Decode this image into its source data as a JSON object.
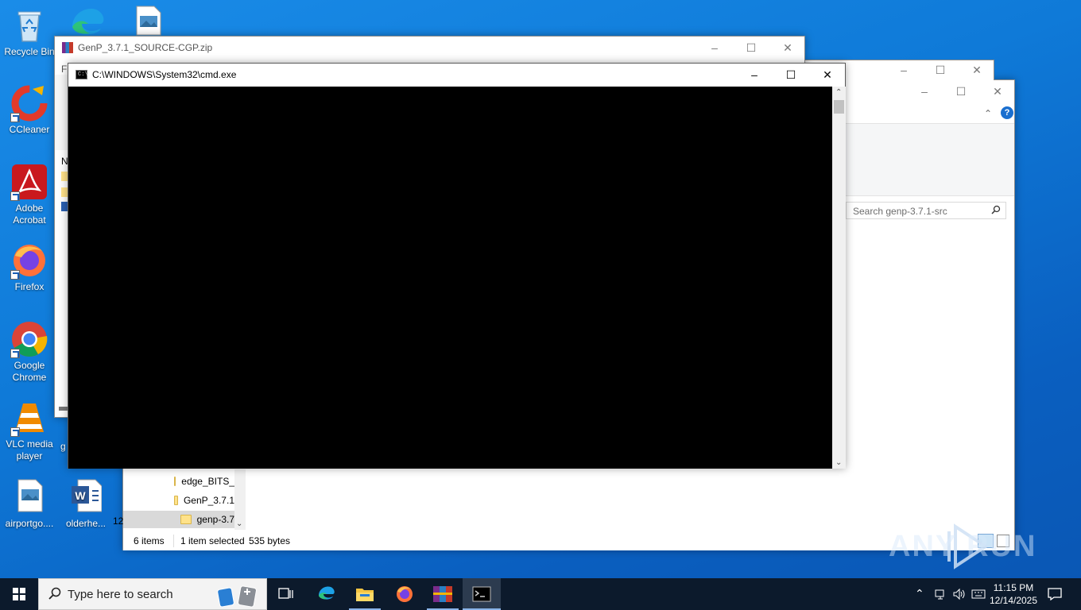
{
  "desktop": {
    "icons": [
      {
        "label": "Recycle Bin"
      },
      {
        "label": "CCleaner"
      },
      {
        "label": "Adobe Acrobat"
      },
      {
        "label": "Firefox"
      },
      {
        "label": "Google Chrome"
      },
      {
        "label": "VLC media player"
      },
      {
        "label": "airportgo...."
      },
      {
        "label": "olderhe..."
      }
    ]
  },
  "winrar_window": {
    "title": "GenP_3.7.1_SOURCE-CGP.zip",
    "menu_partial": "Fi",
    "col_partial": "N"
  },
  "explorer_window": {
    "search_placeholder": "Search genp-3.7.1-src",
    "files": [
      {
        "name": "edge_BITS_"
      },
      {
        "name": "GenP_3.7.1"
      },
      {
        "name": "genp-3.7"
      }
    ],
    "left_partial": "12",
    "status_items": "6 items",
    "status_selected": "1 item selected",
    "status_size": "535 bytes"
  },
  "cmd_window": {
    "title": "C:\\WINDOWS\\System32\\cmd.exe"
  },
  "taskbar": {
    "search_placeholder": "Type here to search",
    "time": "11:15 PM",
    "date": "12/14/2025"
  },
  "watermark": {
    "text": "ANY RUN"
  },
  "colors": {
    "desktop_blue": "#0f7ad8",
    "taskbar": "#0c1a2c",
    "cmd_bg": "#000000"
  }
}
